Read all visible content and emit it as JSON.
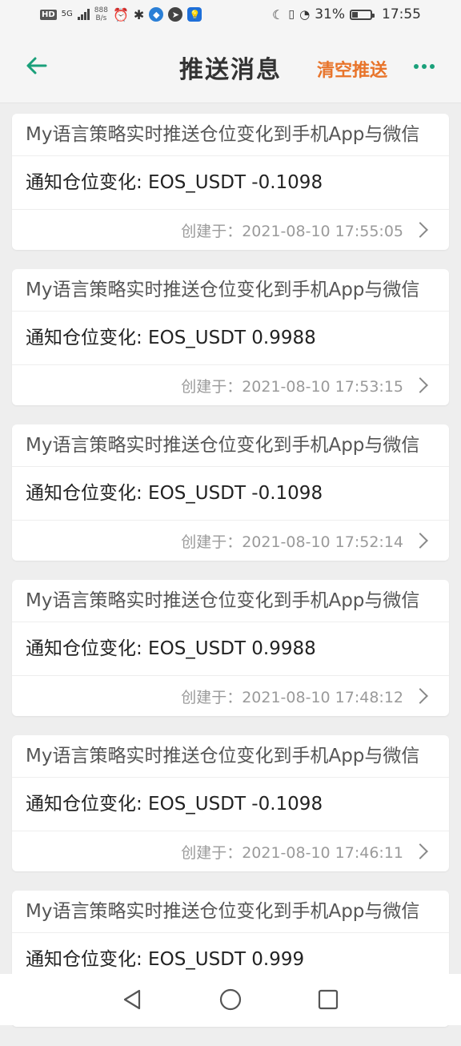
{
  "status_bar": {
    "network_badge": "HD",
    "network_type": "5G",
    "speed_value": "888",
    "speed_unit": "B/s",
    "battery_percent": "31%",
    "battery_level": 0.31,
    "time": "17:55"
  },
  "header": {
    "title": "推送消息",
    "clear_label": "清空推送",
    "accent_color": "#1aa07a",
    "clear_color": "#e8742a"
  },
  "messages": [
    {
      "title": "My语言策略实时推送仓位变化到手机App与微信",
      "body": "通知仓位变化: EOS_USDT -0.1098",
      "created": "创建于：2021-08-10 17:55:05"
    },
    {
      "title": "My语言策略实时推送仓位变化到手机App与微信",
      "body": "通知仓位变化: EOS_USDT 0.9988",
      "created": "创建于：2021-08-10 17:53:15"
    },
    {
      "title": "My语言策略实时推送仓位变化到手机App与微信",
      "body": "通知仓位变化: EOS_USDT -0.1098",
      "created": "创建于：2021-08-10 17:52:14"
    },
    {
      "title": "My语言策略实时推送仓位变化到手机App与微信",
      "body": "通知仓位变化: EOS_USDT 0.9988",
      "created": "创建于：2021-08-10 17:48:12"
    },
    {
      "title": "My语言策略实时推送仓位变化到手机App与微信",
      "body": "通知仓位变化: EOS_USDT -0.1098",
      "created": "创建于：2021-08-10 17:46:11"
    },
    {
      "title": "My语言策略实时推送仓位变化到手机App与微信",
      "body": "通知仓位变化: EOS_USDT 0.999",
      "created": ""
    }
  ]
}
